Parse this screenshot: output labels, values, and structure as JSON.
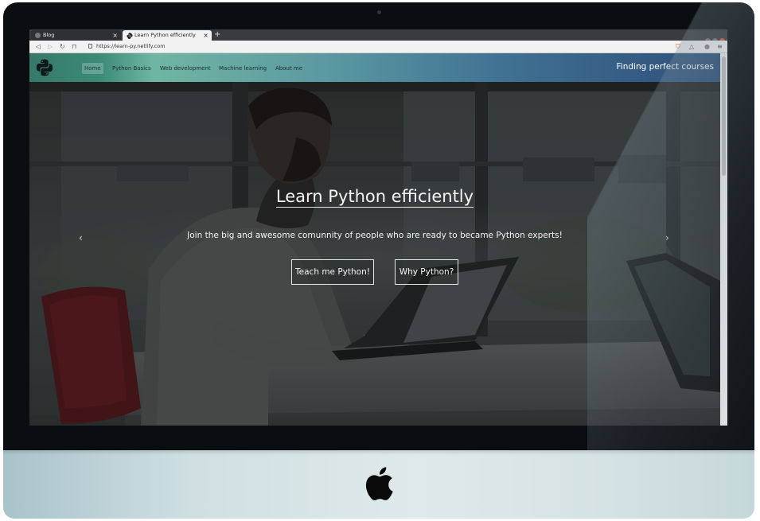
{
  "browser": {
    "tabs": [
      {
        "label": "Blog",
        "close": "×"
      },
      {
        "label": "Learn Python efficiently",
        "close": "×"
      }
    ],
    "new_tab": "+",
    "url": "https://learn-py.netlify.com"
  },
  "site": {
    "nav": [
      {
        "label": "Home"
      },
      {
        "label": "Python Basics"
      },
      {
        "label": "Web development"
      },
      {
        "label": "Machine learning"
      },
      {
        "label": "About me"
      }
    ],
    "tagline": "Finding perfect courses"
  },
  "hero": {
    "title": "Learn Python efficiently",
    "subtitle": "Join the big and awesome comunnity of people who are ready to became Python experts!",
    "button_primary": "Teach me Python!",
    "button_secondary": "Why Python?",
    "prev_arrow": "‹",
    "next_arrow": "›"
  },
  "colors": {
    "navbar_start": "#37796a",
    "navbar_end": "#2e4f7a",
    "bezel": "#0b0e11"
  }
}
